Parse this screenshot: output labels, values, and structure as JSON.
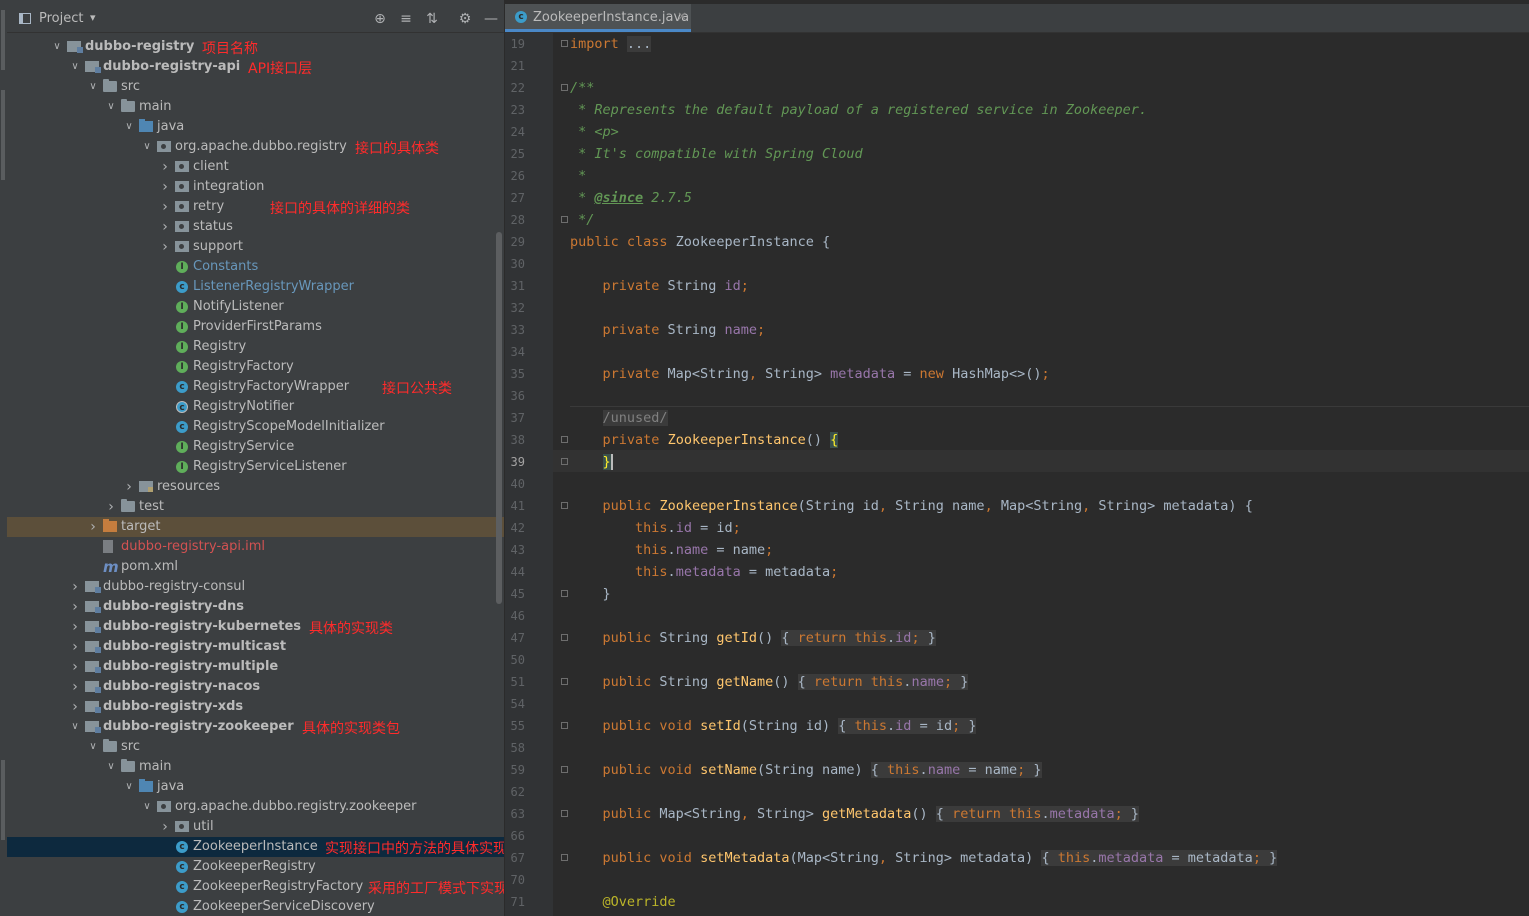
{
  "project": {
    "title": "Project",
    "dropdown": "▾",
    "buttons": [
      "⊕",
      "≡",
      "⇅",
      "⚙",
      "—"
    ]
  },
  "tree": [
    {
      "label": "dubbo-registry",
      "kind": "module",
      "bold": true,
      "expanded": true,
      "indent": 0
    },
    {
      "label": "dubbo-registry-api",
      "kind": "module",
      "bold": true,
      "expanded": true,
      "indent": 1
    },
    {
      "label": "src",
      "kind": "folder",
      "expanded": true,
      "indent": 2
    },
    {
      "label": "main",
      "kind": "folder",
      "expanded": true,
      "indent": 3
    },
    {
      "label": "java",
      "kind": "srcfolder",
      "expanded": true,
      "indent": 4
    },
    {
      "label": "org.apache.dubbo.registry",
      "kind": "pkg",
      "expanded": true,
      "indent": 5
    },
    {
      "label": "client",
      "kind": "pkg",
      "expanded": false,
      "indent": 6
    },
    {
      "label": "integration",
      "kind": "pkg",
      "expanded": false,
      "indent": 6
    },
    {
      "label": "retry",
      "kind": "pkg",
      "expanded": false,
      "indent": 6
    },
    {
      "label": "status",
      "kind": "pkg",
      "expanded": false,
      "indent": 6
    },
    {
      "label": "support",
      "kind": "pkg",
      "expanded": false,
      "indent": 6
    },
    {
      "label": "Constants",
      "kind": "iface",
      "color": "blue",
      "indent": 6
    },
    {
      "label": "ListenerRegistryWrapper",
      "kind": "cls",
      "color": "blue",
      "indent": 6
    },
    {
      "label": "NotifyListener",
      "kind": "iface",
      "indent": 6
    },
    {
      "label": "ProviderFirstParams",
      "kind": "iface",
      "indent": 6
    },
    {
      "label": "Registry",
      "kind": "iface",
      "indent": 6
    },
    {
      "label": "RegistryFactory",
      "kind": "iface",
      "indent": 6
    },
    {
      "label": "RegistryFactoryWrapper",
      "kind": "cls",
      "indent": 6
    },
    {
      "label": "RegistryNotifier",
      "kind": "enm",
      "indent": 6
    },
    {
      "label": "RegistryScopeModelInitializer",
      "kind": "cls",
      "indent": 6
    },
    {
      "label": "RegistryService",
      "kind": "iface",
      "indent": 6
    },
    {
      "label": "RegistryServiceListener",
      "kind": "iface",
      "indent": 6
    },
    {
      "label": "resources",
      "kind": "resfolder",
      "expanded": false,
      "indent": 4
    },
    {
      "label": "test",
      "kind": "folder",
      "expanded": false,
      "indent": 3
    },
    {
      "label": "target",
      "kind": "target",
      "expanded": false,
      "indent": 2,
      "highlight": "target"
    },
    {
      "label": "dubbo-registry-api.iml",
      "kind": "iml",
      "color": "red",
      "indent": 2
    },
    {
      "label": "pom.xml",
      "kind": "mvn",
      "indent": 2
    },
    {
      "label": "dubbo-registry-consul",
      "kind": "module",
      "expanded": false,
      "indent": 1
    },
    {
      "label": "dubbo-registry-dns",
      "kind": "module",
      "bold": true,
      "expanded": false,
      "indent": 1
    },
    {
      "label": "dubbo-registry-kubernetes",
      "kind": "module",
      "bold": true,
      "expanded": false,
      "indent": 1
    },
    {
      "label": "dubbo-registry-multicast",
      "kind": "module",
      "bold": true,
      "expanded": false,
      "indent": 1
    },
    {
      "label": "dubbo-registry-multiple",
      "kind": "module",
      "bold": true,
      "expanded": false,
      "indent": 1
    },
    {
      "label": "dubbo-registry-nacos",
      "kind": "module",
      "bold": true,
      "expanded": false,
      "indent": 1
    },
    {
      "label": "dubbo-registry-xds",
      "kind": "module",
      "bold": true,
      "expanded": false,
      "indent": 1
    },
    {
      "label": "dubbo-registry-zookeeper",
      "kind": "module",
      "bold": true,
      "expanded": true,
      "indent": 1
    },
    {
      "label": "src",
      "kind": "folder",
      "expanded": true,
      "indent": 2
    },
    {
      "label": "main",
      "kind": "folder",
      "expanded": true,
      "indent": 3
    },
    {
      "label": "java",
      "kind": "srcfolder",
      "expanded": true,
      "indent": 4
    },
    {
      "label": "org.apache.dubbo.registry.zookeeper",
      "kind": "pkg",
      "expanded": true,
      "indent": 5
    },
    {
      "label": "util",
      "kind": "pkg",
      "expanded": false,
      "indent": 6
    },
    {
      "label": "ZookeeperInstance",
      "kind": "cls",
      "indent": 6,
      "highlight": "selected"
    },
    {
      "label": "ZookeeperRegistry",
      "kind": "cls",
      "indent": 6
    },
    {
      "label": "ZookeeperRegistryFactory",
      "kind": "cls",
      "indent": 6
    },
    {
      "label": "ZookeeperServiceDiscovery",
      "kind": "cls",
      "indent": 6
    }
  ],
  "annotations": [
    {
      "text": "项目名称",
      "row": 0,
      "after": "dubbo-registry"
    },
    {
      "text": "API接口层",
      "row": 1,
      "after": "dubbo-registry-api"
    },
    {
      "text": "接口的具体类",
      "row": 5,
      "after": "org.apache.dubbo.registry"
    },
    {
      "text": "接口的具体的详细的类",
      "row": 8,
      "free": "retry-note"
    },
    {
      "text": "接口公共类",
      "row": 17,
      "free": "common-note"
    },
    {
      "text": "具体的实现类",
      "row": 29,
      "after": "dubbo-registry-kubernetes"
    },
    {
      "text": "具体的实现类包",
      "row": 34,
      "after": "dubbo-registry-zookeeper"
    },
    {
      "text": "实现接口中的方法的具体实现类",
      "row": 40,
      "free": "impl-note"
    },
    {
      "text": "采用的工厂模式下实现接口中的方法",
      "row": 42,
      "free": "factory-note"
    }
  ],
  "editor": {
    "tab_label": "ZookeeperInstance.java",
    "tab_close": "×",
    "current_line": "39",
    "lines": [
      {
        "n": "19",
        "html": "<span class=\"kw\">import</span> <span class=\"fold-bg\">...</span>",
        "fold": true
      },
      {
        "n": "21",
        "html": ""
      },
      {
        "n": "22",
        "html": "<span class=\"cm\">/**</span>",
        "fold": true
      },
      {
        "n": "23",
        "html": "<span class=\"cm\"> * Represents the default payload of a registered service in Zookeeper.</span>"
      },
      {
        "n": "24",
        "html": "<span class=\"cm\"> * &lt;p&gt;</span>"
      },
      {
        "n": "25",
        "html": "<span class=\"cm\"> * It's compatible with Spring Cloud</span>"
      },
      {
        "n": "26",
        "html": "<span class=\"cm\"> *</span>"
      },
      {
        "n": "27",
        "html": "<span class=\"cm\"> * </span><span class=\"tag\">@since</span><span class=\"cm\"> 2.7.5</span>"
      },
      {
        "n": "28",
        "html": "<span class=\"cm\"> */</span>",
        "fold": true
      },
      {
        "n": "29",
        "html": "<span class=\"kw\">public class</span> ZookeeperInstance {"
      },
      {
        "n": "30",
        "html": ""
      },
      {
        "n": "31",
        "html": "    <span class=\"kw\">private</span> String <span class=\"fld\">id</span><span class=\"kw\">;</span>"
      },
      {
        "n": "32",
        "html": ""
      },
      {
        "n": "33",
        "html": "    <span class=\"kw\">private</span> String <span class=\"fld\">name</span><span class=\"kw\">;</span>"
      },
      {
        "n": "34",
        "html": ""
      },
      {
        "n": "35",
        "html": "    <span class=\"kw\">private</span> Map&lt;String<span class=\"kw\">,</span> String&gt; <span class=\"fld\">metadata</span> = <span class=\"kw\">new</span> HashMap&lt;&gt;()<span class=\"kw\">;</span>"
      },
      {
        "n": "36",
        "html": ""
      },
      {
        "n": "37",
        "html": "    <span class=\"fold-bg dim\">/unused/</span>"
      },
      {
        "n": "38",
        "html": "    <span class=\"kw\">private</span> <span class=\"mth\">ZookeeperInstance</span>() <span style=\"color:#ffef28;background:#3b514d\">{</span>",
        "fold": true
      },
      {
        "n": "39",
        "html": "    <span style=\"color:#ffef28;background:#3b514d\">}</span><span class=\"caret\"></span>",
        "fold": true
      },
      {
        "n": "40",
        "html": ""
      },
      {
        "n": "41",
        "html": "    <span class=\"kw\">public</span> <span class=\"mth\">ZookeeperInstance</span>(String id<span class=\"kw\">,</span> String name<span class=\"kw\">,</span> Map&lt;String<span class=\"kw\">,</span> String&gt; metadata) {",
        "fold": true
      },
      {
        "n": "42",
        "html": "        <span class=\"kw\">this</span>.<span class=\"fld\">id</span> = id<span class=\"kw\">;</span>"
      },
      {
        "n": "43",
        "html": "        <span class=\"kw\">this</span>.<span class=\"fld\">name</span> = name<span class=\"kw\">;</span>"
      },
      {
        "n": "44",
        "html": "        <span class=\"kw\">this</span>.<span class=\"fld\">metadata</span> = metadata<span class=\"kw\">;</span>"
      },
      {
        "n": "45",
        "html": "    }",
        "fold": true
      },
      {
        "n": "46",
        "html": ""
      },
      {
        "n": "47",
        "html": "    <span class=\"kw\">public</span> String <span class=\"mth\">getId</span>() <span class=\"fold-bg\">{ <span class=\"kw\">return this</span>.<span class=\"fld\">id</span><span class=\"kw\">;</span> }</span>",
        "fold": true
      },
      {
        "n": "50",
        "html": ""
      },
      {
        "n": "51",
        "html": "    <span class=\"kw\">public</span> String <span class=\"mth\">getName</span>() <span class=\"fold-bg\">{ <span class=\"kw\">return this</span>.<span class=\"fld\">name</span><span class=\"kw\">;</span> }</span>",
        "fold": true
      },
      {
        "n": "54",
        "html": ""
      },
      {
        "n": "55",
        "html": "    <span class=\"kw\">public void</span> <span class=\"mth\">setId</span>(String id) <span class=\"fold-bg\">{ <span class=\"kw\">this</span>.<span class=\"fld\">id</span> = id<span class=\"kw\">;</span> }</span>",
        "fold": true
      },
      {
        "n": "58",
        "html": ""
      },
      {
        "n": "59",
        "html": "    <span class=\"kw\">public void</span> <span class=\"mth\">setName</span>(String name) <span class=\"fold-bg\">{ <span class=\"kw\">this</span>.<span class=\"fld\">name</span> = name<span class=\"kw\">;</span> }</span>",
        "fold": true
      },
      {
        "n": "62",
        "html": ""
      },
      {
        "n": "63",
        "html": "    <span class=\"kw\">public</span> Map&lt;String<span class=\"kw\">,</span> String&gt; <span class=\"mth\">getMetadata</span>() <span class=\"fold-bg\">{ <span class=\"kw\">return this</span>.<span class=\"fld\">metadata</span><span class=\"kw\">;</span> }</span>",
        "fold": true
      },
      {
        "n": "66",
        "html": ""
      },
      {
        "n": "67",
        "html": "    <span class=\"kw\">public void</span> <span class=\"mth\">setMetadata</span>(Map&lt;String<span class=\"kw\">,</span> String&gt; metadata) <span class=\"fold-bg\">{ <span class=\"kw\">this</span>.<span class=\"fld\">metadata</span> = metadata<span class=\"kw\">;</span> }</span>",
        "fold": true
      },
      {
        "n": "70",
        "html": ""
      },
      {
        "n": "71",
        "html": "    <span class=\"ann-ann\">@Override</span>"
      }
    ]
  },
  "colors": {
    "background": "#2b2b2b",
    "panel": "#3c3f41",
    "annotation_red": "#ff2b2b",
    "selection": "#0d293e",
    "target_highlight": "#5c4f3a"
  }
}
